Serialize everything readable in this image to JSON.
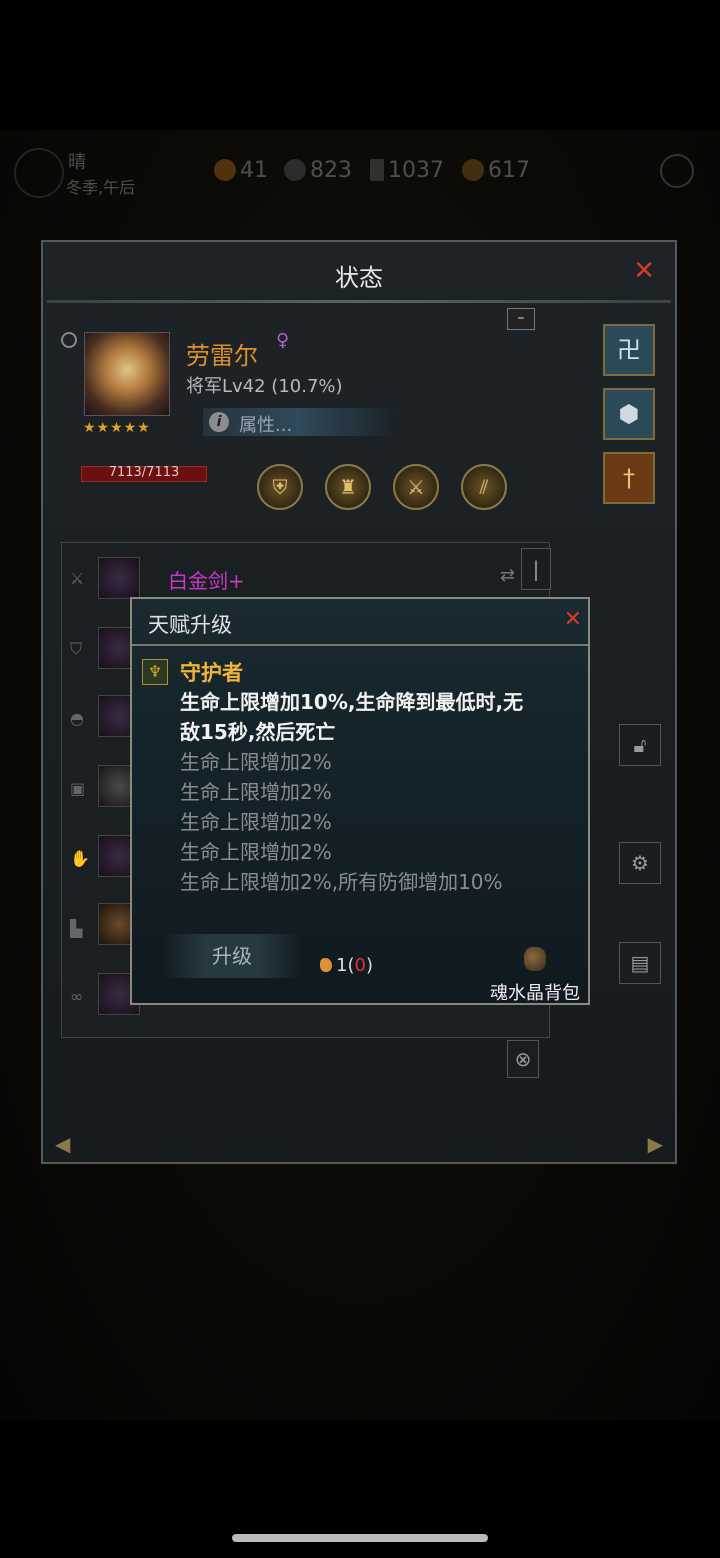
{
  "hud": {
    "weather": "晴",
    "season_time": "冬季,午后",
    "resources": [
      "41",
      "823",
      "1037",
      "617"
    ]
  },
  "status_panel": {
    "title": "状态",
    "collapse": "–",
    "hero": {
      "name": "劳雷尔",
      "gender_icon": "♀",
      "rank": "将军Lv42 (10.7%)",
      "stars": "★★★★★",
      "attributes_label": "属性...",
      "hp": "7113/7113"
    },
    "equipment": {
      "weapon_name": "白金剑+"
    }
  },
  "talent_dialog": {
    "title": "天赋升级",
    "talent_name": "守护者",
    "desc_main_1": "生命上限增加10%,生命降到最低时,无",
    "desc_main_2": "敌15秒,然后死亡",
    "levels": [
      "生命上限增加2%",
      "生命上限增加2%",
      "生命上限增加2%",
      "生命上限增加2%",
      "生命上限增加2%,所有防御增加10%"
    ],
    "upgrade_label": "升级",
    "cost_prefix": "1(",
    "cost_owned": "0",
    "cost_suffix": ")",
    "bag_label": "魂水晶背包"
  },
  "colors": {
    "accent_orange": "#e0902a",
    "close_red": "#d43a2a",
    "item_purple": "#c83ac8",
    "talent_gold": "#f0b43a"
  }
}
